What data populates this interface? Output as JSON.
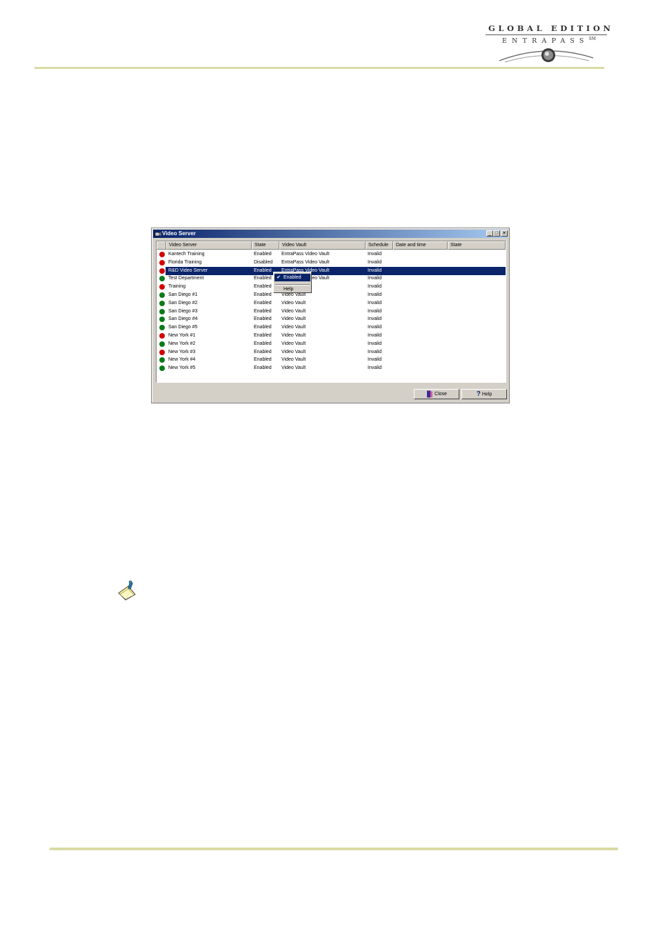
{
  "logo": {
    "line1": "GLOBAL EDITION",
    "line2": "ENTRAPASS",
    "mark": "SM"
  },
  "window": {
    "title": "Video Server",
    "columns": [
      "Video Server",
      "State",
      "Video Vault",
      "Schedule",
      "Date and time",
      "State"
    ],
    "rows": [
      {
        "name": "Kantech Training",
        "state": "Enabled",
        "vault": "EntraPass Video Vault",
        "schedule": "Invalid",
        "status": "red"
      },
      {
        "name": "Florida Training",
        "state": "Disabled",
        "vault": "EntraPass Video Vault",
        "schedule": "Invalid",
        "status": "red"
      },
      {
        "name": "R&D Video Server",
        "state": "Enabled",
        "vault": "EntraPass Video Vault",
        "schedule": "Invalid",
        "status": "red"
      },
      {
        "name": "Test Department",
        "state": "Enabled",
        "vault": "EntraPass Video Vault",
        "schedule": "Invalid",
        "status": "green"
      },
      {
        "name": "Training",
        "state": "Enabled",
        "vault": "Video Vault",
        "schedule": "Invalid",
        "status": "red"
      },
      {
        "name": "San Diego #1",
        "state": "Enabled",
        "vault": "Video Vault",
        "schedule": "Invalid",
        "status": "green"
      },
      {
        "name": "San Diego #2",
        "state": "Enabled",
        "vault": "Video Vault",
        "schedule": "Invalid",
        "status": "green"
      },
      {
        "name": "San Diego #3",
        "state": "Enabled",
        "vault": "Video Vault",
        "schedule": "Invalid",
        "status": "green"
      },
      {
        "name": "San Diego #4",
        "state": "Enabled",
        "vault": "Video Vault",
        "schedule": "Invalid",
        "status": "green"
      },
      {
        "name": "San Diego #5",
        "state": "Enabled",
        "vault": "Video Vault",
        "schedule": "Invalid",
        "status": "green"
      },
      {
        "name": "New York #1",
        "state": "Enabled",
        "vault": "Video Vault",
        "schedule": "Invalid",
        "status": "red"
      },
      {
        "name": "New York #2",
        "state": "Enabled",
        "vault": "Video Vault",
        "schedule": "Invalid",
        "status": "green"
      },
      {
        "name": "New York #3",
        "state": "Enabled",
        "vault": "Video Vault",
        "schedule": "Invalid",
        "status": "red"
      },
      {
        "name": "New York #4",
        "state": "Enabled",
        "vault": "Video Vault",
        "schedule": "Invalid",
        "status": "green"
      },
      {
        "name": "New York #5",
        "state": "Enabled",
        "vault": "Video Vault",
        "schedule": "Invalid",
        "status": "green"
      }
    ],
    "selected_row": 2,
    "context_menu": {
      "items": [
        "Enabled",
        "Help"
      ],
      "checked": "Enabled"
    },
    "buttons": {
      "close": "Close",
      "help": "Help"
    }
  },
  "colors": {
    "accent_rule": "#d9dba4",
    "selection": "#0a246a",
    "status_red": "#d40000",
    "status_green": "#0a7a1a"
  },
  "icons": [
    "note-pad-icon"
  ]
}
